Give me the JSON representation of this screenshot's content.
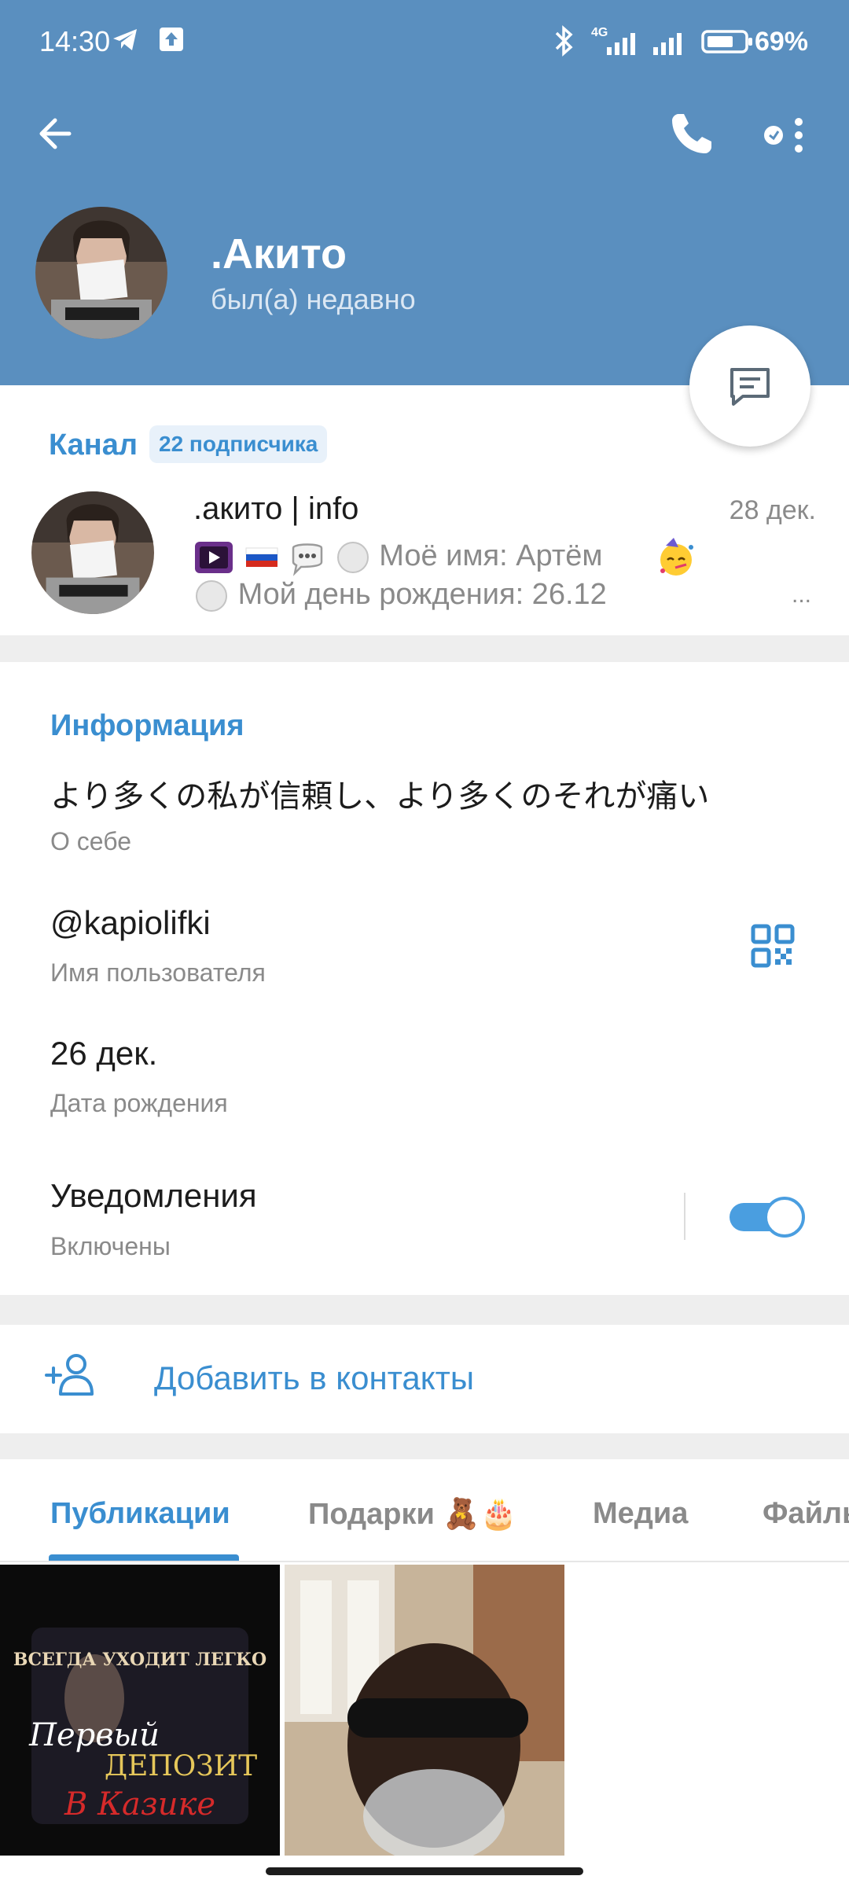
{
  "status": {
    "time": "14:30",
    "network": "4G",
    "battery": "69%"
  },
  "profile": {
    "name": ".Акито",
    "last_seen": "был(а) недавно"
  },
  "channel": {
    "label": "Канал",
    "subscribers": "22 подписчика",
    "name": ".акито | info",
    "date": "28 дек.",
    "line1": "Моё имя: Артём",
    "line2": "Мой день рождения: 26.12",
    "ellipsis": "..."
  },
  "info": {
    "title": "Информация",
    "bio": "より多くの私が信頼し、より多くのそれが痛い",
    "bio_label": "О себе",
    "username": "@kapiolifki",
    "username_label": "Имя пользователя",
    "birthday": "26 дек.",
    "birthday_label": "Дата рождения",
    "notifications": "Уведомления",
    "notifications_status": "Включены",
    "notifications_on": true
  },
  "add_contact": {
    "label": "Добавить в контакты"
  },
  "tabs": [
    {
      "label": "Публикации",
      "active": true
    },
    {
      "label": "Подарки 🧸🎂",
      "active": false
    },
    {
      "label": "Медиа",
      "active": false
    },
    {
      "label": "Файлы",
      "active": false
    }
  ],
  "media_posts": [
    {
      "caption_top": "ВСЕГДА УХОДИТ ЛЕГКО",
      "caption_mid": "Первый",
      "caption_mid2": "ДЕПОЗИТ",
      "caption_bottom": "В Казике"
    },
    {
      "caption_top": ""
    }
  ],
  "colors": {
    "header": "#5a8fbf",
    "accent": "#3a8ed0",
    "toggle": "#4a9ee0"
  }
}
